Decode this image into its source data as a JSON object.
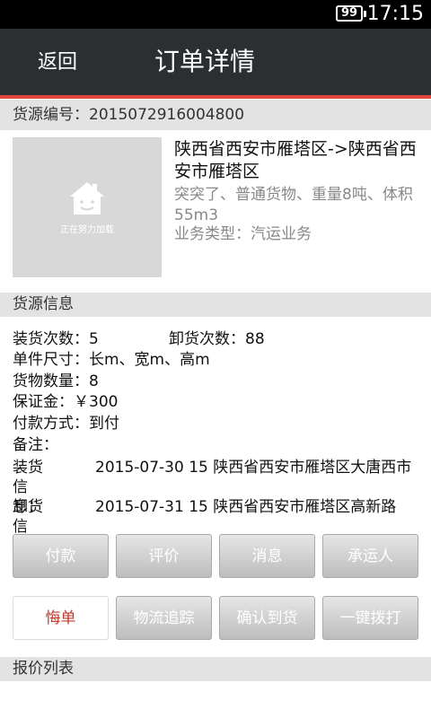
{
  "status_bar": {
    "battery": "99",
    "time": "17:15"
  },
  "header": {
    "back_label": "返回",
    "title": "订单详情"
  },
  "source_no": {
    "label": "货源编号：",
    "value": "2015072916004800"
  },
  "summary": {
    "thumbnail_loading_text": "正在努力加载",
    "route": "陕西省西安市雁塔区->陕西省西安市雁塔区",
    "description": "突突了、普通货物、重量8吨、体积55m3",
    "business_type": "业务类型：汽运业务"
  },
  "cargo_info": {
    "header": "货源信息",
    "loading_count": "装货次数：5",
    "unloading_count": "卸货次数：88",
    "size": "单件尺寸：长m、宽m、高m",
    "quantity": "货物数量：8",
    "deposit": "保证金：￥300",
    "payment": "付款方式：到付",
    "remark": "备注：",
    "loading_label": "装货信息：",
    "loading_value": "2015-07-30 15  陕西省西安市雁塔区大唐西市",
    "unloading_label": "卸货信息：",
    "unloading_value": "2015-07-31 15  陕西省西安市雁塔区高新路"
  },
  "actions_row1": [
    "付款",
    "评价",
    "消息",
    "承运人"
  ],
  "actions_row2": [
    "悔单",
    "物流追踪",
    "确认到货",
    "一键拨打"
  ],
  "quote_list": {
    "header": "报价列表"
  }
}
